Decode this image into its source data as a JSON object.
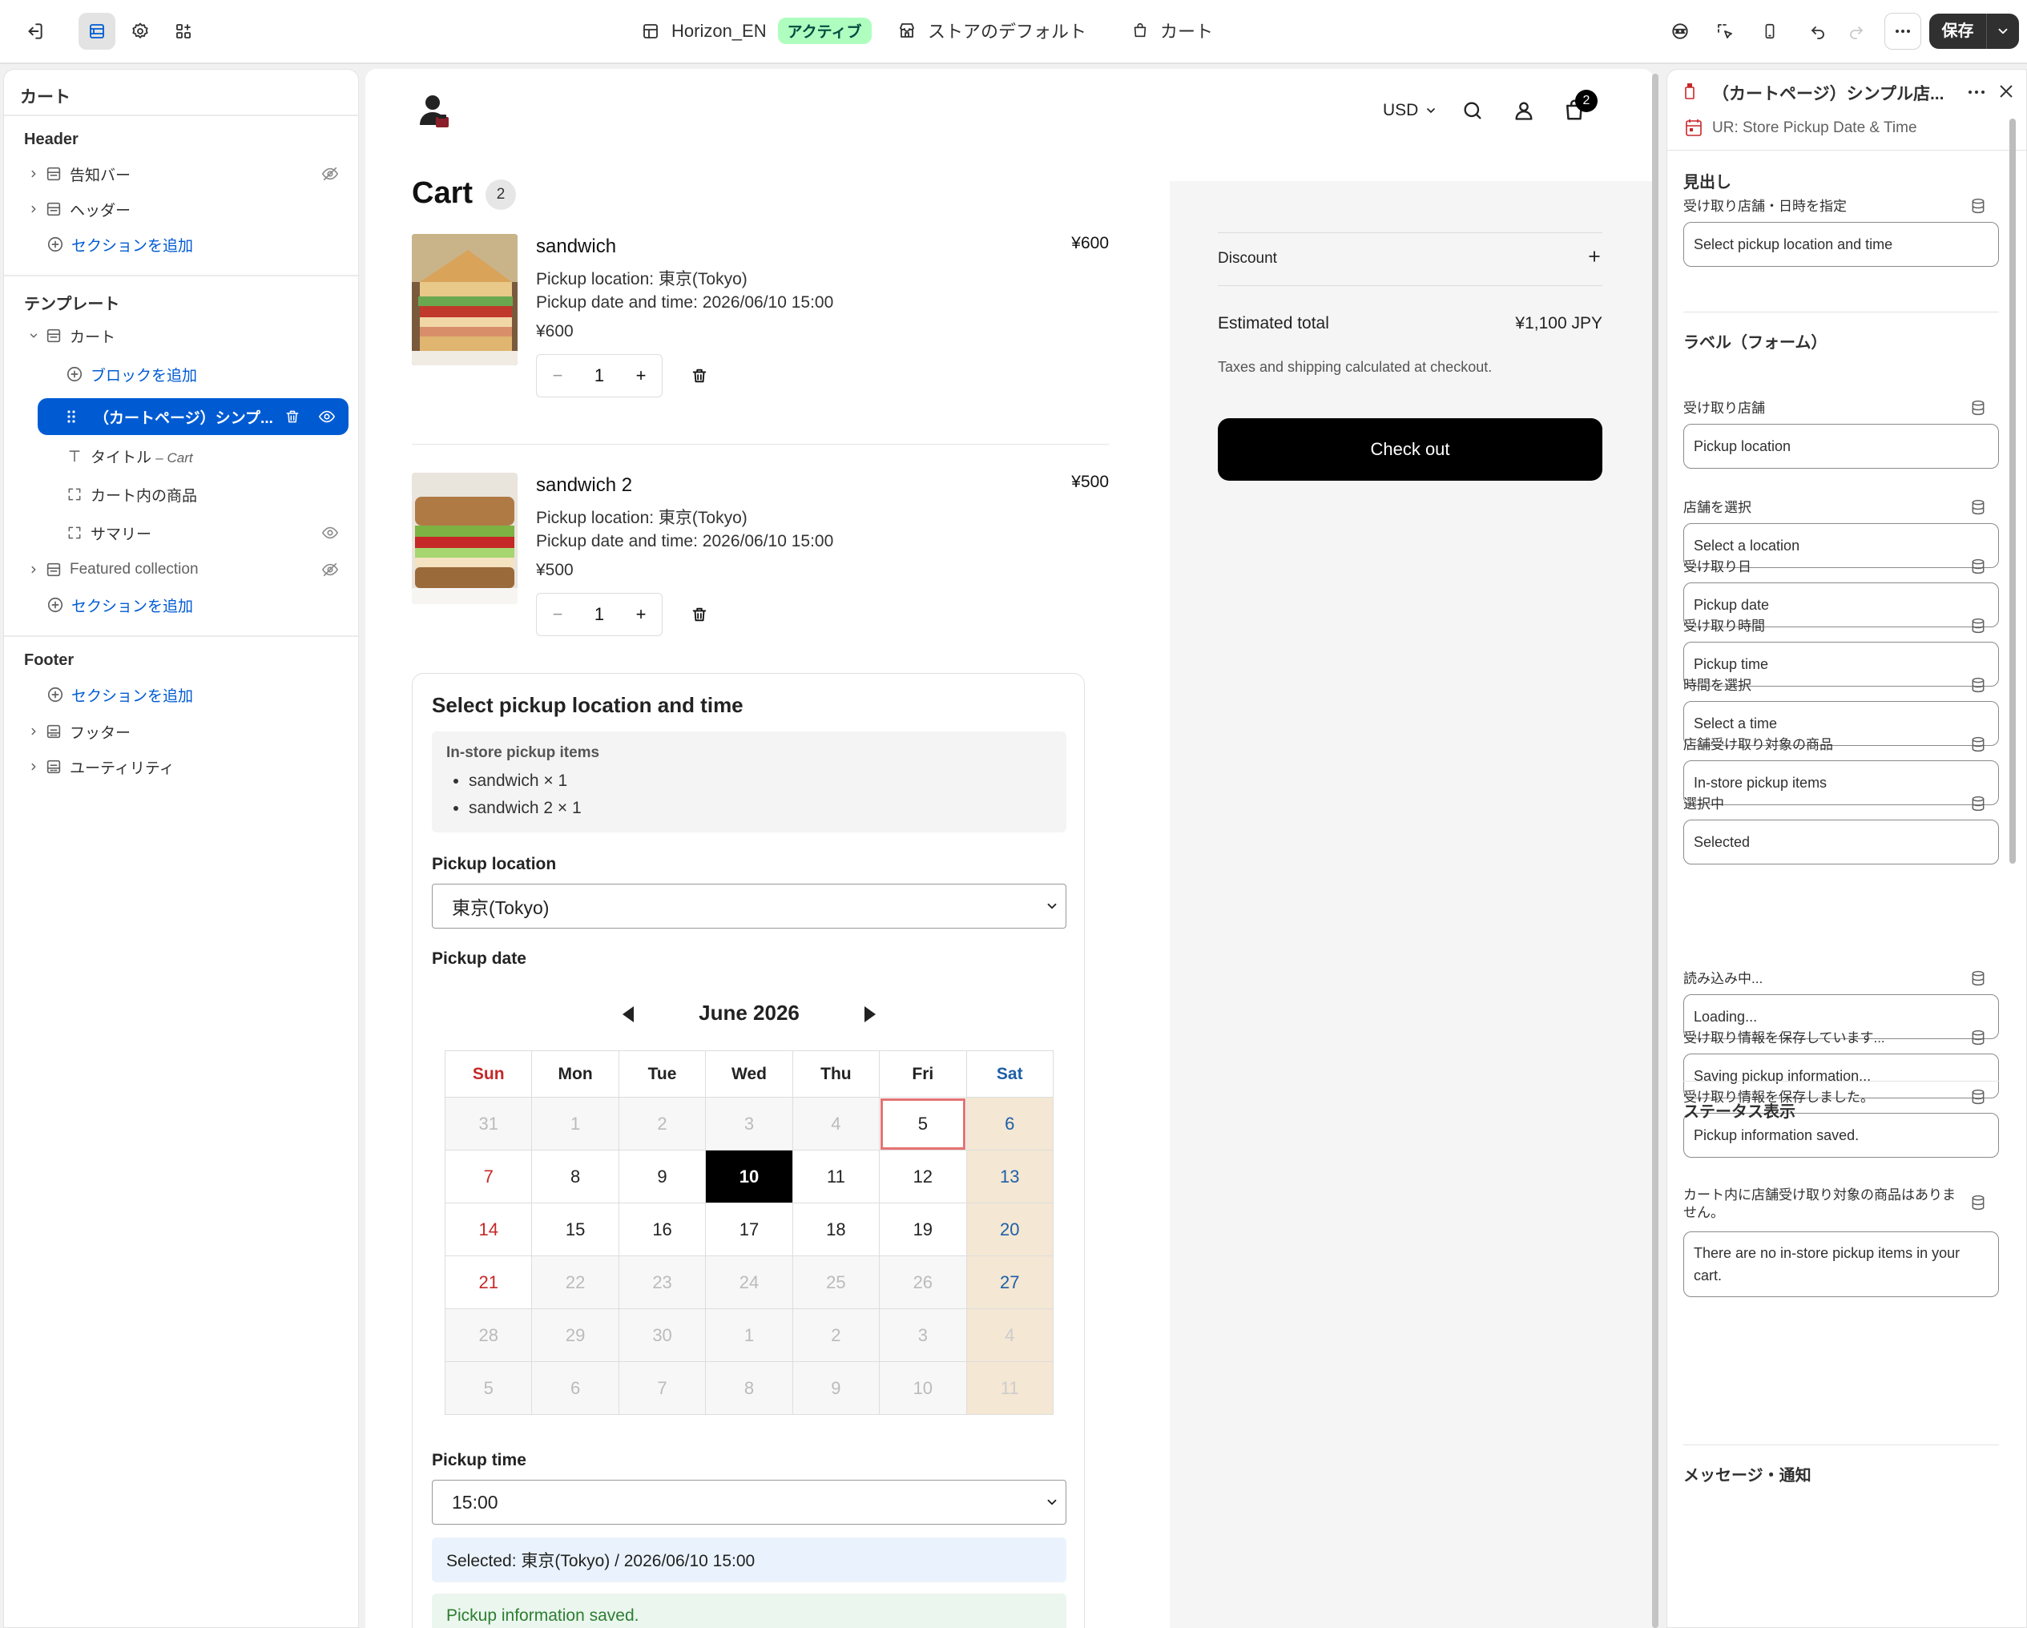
{
  "topbar": {
    "theme_name": "Horizon_EN",
    "theme_status": "アクティブ",
    "store_default": "ストアのデフォルト",
    "page": "カート",
    "save_label": "保存"
  },
  "left": {
    "title": "カート",
    "header_heading": "Header",
    "header_items": [
      "告知バー",
      "ヘッダー"
    ],
    "add_section": "セクションを追加",
    "template_heading": "テンプレート",
    "template_section": "カート",
    "add_block": "ブロックを追加",
    "selected_block": "（カートページ）シンプ...",
    "blocks": {
      "title_label": "タイトル",
      "title_sub": "– Cart",
      "items": "カート内の商品",
      "summary": "サマリー"
    },
    "featured": "Featured collection",
    "footer_heading": "Footer",
    "footer_items": [
      "フッター",
      "ユーティリティ"
    ]
  },
  "store": {
    "currency": "USD",
    "cart_count": "2",
    "cart_title": "Cart",
    "cart_badge": "2"
  },
  "cart_items": [
    {
      "name": "sandwich",
      "price": "¥600",
      "location": "Pickup location: 東京(Tokyo)",
      "datetime": "Pickup date and time: 2026/06/10 15:00",
      "line_price": "¥600",
      "qty": "1"
    },
    {
      "name": "sandwich 2",
      "price": "¥500",
      "location": "Pickup location: 東京(Tokyo)",
      "datetime": "Pickup date and time: 2026/06/10 15:00",
      "line_price": "¥500",
      "qty": "1"
    }
  ],
  "pickup": {
    "title": "Select pickup location and time",
    "items_heading": "In-store pickup items",
    "items": [
      "sandwich × 1",
      "sandwich 2 × 1"
    ],
    "location_label": "Pickup location",
    "location_value": "東京(Tokyo)",
    "date_label": "Pickup date",
    "month": "June 2026",
    "weekdays": [
      "Sun",
      "Mon",
      "Tue",
      "Wed",
      "Thu",
      "Fri",
      "Sat"
    ],
    "weeks": [
      [
        "31",
        "1",
        "2",
        "3",
        "4",
        "5",
        "6"
      ],
      [
        "7",
        "8",
        "9",
        "10",
        "11",
        "12",
        "13"
      ],
      [
        "14",
        "15",
        "16",
        "17",
        "18",
        "19",
        "20"
      ],
      [
        "21",
        "22",
        "23",
        "24",
        "25",
        "26",
        "27"
      ],
      [
        "28",
        "29",
        "30",
        "1",
        "2",
        "3",
        "4"
      ],
      [
        "5",
        "6",
        "7",
        "8",
        "9",
        "10",
        "11"
      ]
    ],
    "time_label": "Pickup time",
    "time_value": "15:00",
    "selected_text": "Selected: 東京(Tokyo) / 2026/06/10 15:00",
    "saved_text": "Pickup information saved."
  },
  "summary": {
    "discount": "Discount",
    "total_label": "Estimated total",
    "total_value": "¥1,100 JPY",
    "tax_note": "Taxes and shipping calculated at checkout.",
    "checkout": "Check out"
  },
  "right": {
    "title": "（カートページ）シンプル店...",
    "app_name": "UR: Store Pickup Date & Time",
    "sections": {
      "heading": "見出し",
      "labels": "ラベル（フォーム）",
      "status": "ステータス表示",
      "messages": "メッセージ・通知"
    },
    "fields": [
      {
        "label": "受け取り店舗・日時を指定",
        "value": "Select pickup location and time"
      },
      {
        "label": "受け取り店舗",
        "value": "Pickup location"
      },
      {
        "label": "店舗を選択",
        "value": "Select a location"
      },
      {
        "label": "受け取り日",
        "value": "Pickup date"
      },
      {
        "label": "受け取り時間",
        "value": "Pickup time"
      },
      {
        "label": "時間を選択",
        "value": "Select a time"
      },
      {
        "label": "店舗受け取り対象の商品",
        "value": "In-store pickup items"
      },
      {
        "label": "選択中",
        "value": "Selected"
      },
      {
        "label": "読み込み中...",
        "value": "Loading..."
      },
      {
        "label": "受け取り情報を保存しています...",
        "value": "Saving pickup information..."
      },
      {
        "label": "受け取り情報を保存しました。",
        "value": "Pickup information saved."
      },
      {
        "label": "カート内に店舗受け取り対象の商品はありません。",
        "value": "There are no in-store pickup items in your cart."
      }
    ]
  }
}
